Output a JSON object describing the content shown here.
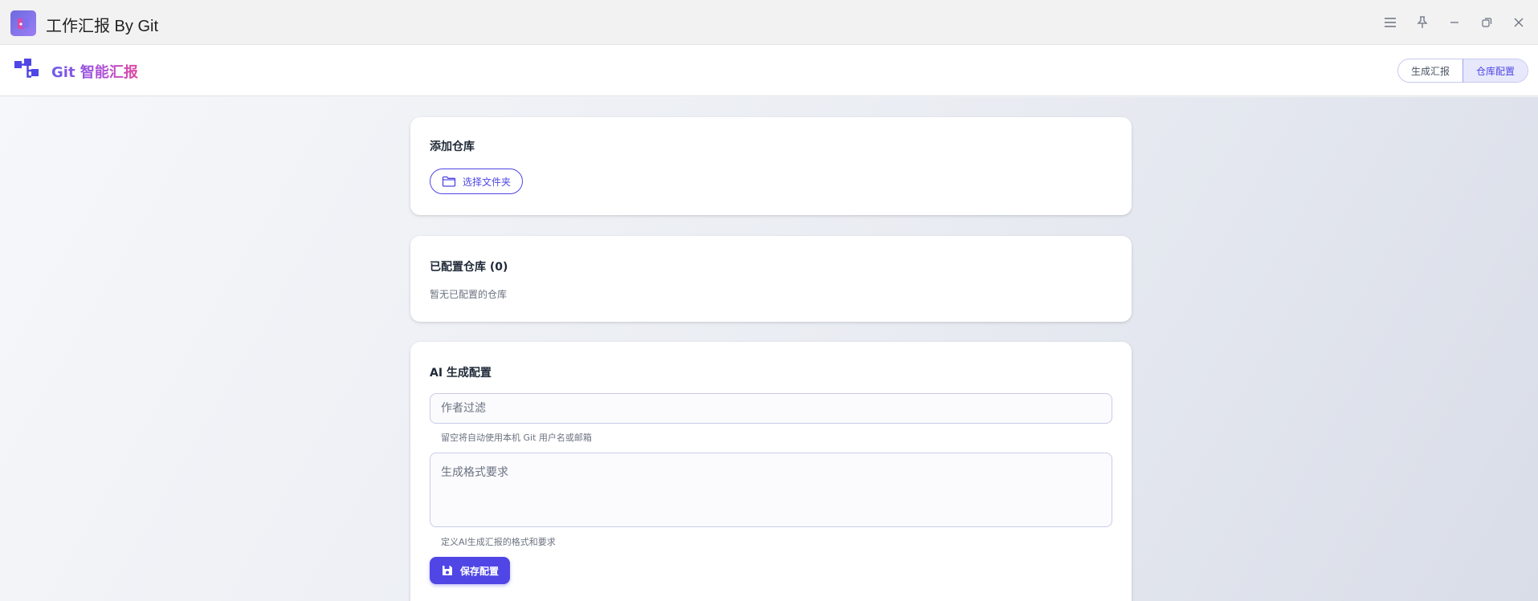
{
  "window": {
    "title": "工作汇报 By Git",
    "controls": [
      "menu-icon",
      "pin-icon",
      "minimize-icon",
      "restore-icon",
      "close-icon"
    ]
  },
  "header": {
    "brand": "Git 智能汇报",
    "tabs": [
      {
        "label": "生成汇报",
        "active": false
      },
      {
        "label": "仓库配置",
        "active": true
      }
    ]
  },
  "add_repo": {
    "title": "添加仓库",
    "select_folder_label": "选择文件夹"
  },
  "configured": {
    "title": "已配置仓库 (0)",
    "empty_text": "暂无已配置的仓库"
  },
  "ai_config": {
    "title": "AI 生成配置",
    "author_placeholder": "作者过滤",
    "author_value": "",
    "author_hint": "留空将自动使用本机 Git 用户名或邮箱",
    "format_placeholder": "生成格式要求",
    "format_value": "",
    "format_hint": "定义AI生成汇报的格式和要求",
    "save_label": "保存配置"
  },
  "colors": {
    "accent": "#4f46e5",
    "brand_gradient_start": "#6d5ce8",
    "brand_gradient_end": "#e0489f"
  }
}
